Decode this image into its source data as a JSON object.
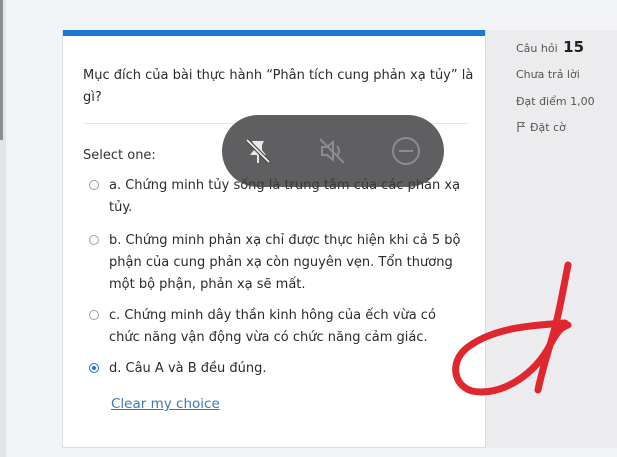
{
  "question": {
    "text": "Mục đích của bài thực hành “Phân tích cung phản xạ tủy” là gì?",
    "select_label": "Select one:",
    "options": [
      {
        "label": "a. Chứng minh tủy sống là trung tâm của các phản xạ tủy.",
        "selected": false
      },
      {
        "label": "b. Chứng minh phản xạ chỉ được thực hiện khi cả 5 bộ phận của cung phản xạ còn nguyên vẹn. Tổn thương một bộ phận, phản xạ sẽ mất.",
        "selected": false
      },
      {
        "label": "c. Chứng minh dây thần kinh hông của ếch vừa có chức năng vận động vừa có chức năng cảm giác.",
        "selected": false
      },
      {
        "label": "d. Câu A và B đều đúng.",
        "selected": true
      }
    ],
    "clear_label": "Clear my choice"
  },
  "info": {
    "question_label": "Câu hỏi",
    "question_number": "15",
    "status": "Chưa trả lời",
    "points": "Đạt điểm 1,00",
    "flag_label": "Đặt cờ"
  },
  "overlay_icons": [
    "pin-off-icon",
    "mute-icon",
    "minus-circle-icon"
  ],
  "colors": {
    "accent": "#1a7ad3",
    "link": "#3b78b9",
    "annotation": "#e0262f"
  }
}
